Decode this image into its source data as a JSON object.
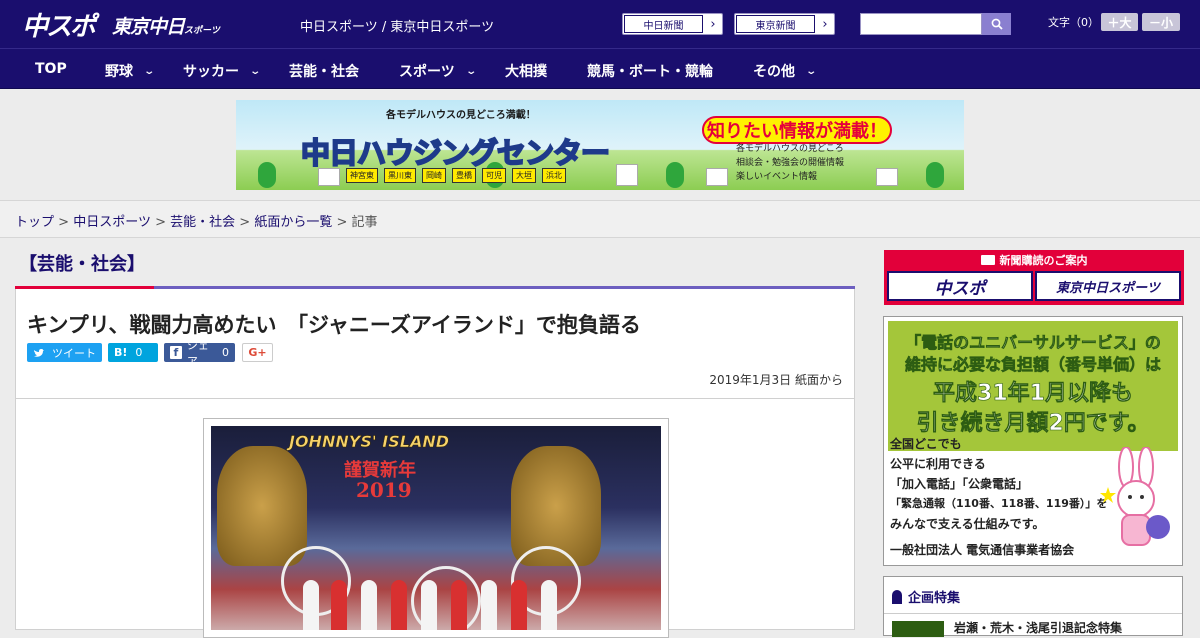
{
  "header": {
    "logo_primary": "中スポ",
    "logo_secondary": "東京中日",
    "logo_secondary_small": "スポーツ",
    "site_title": "中日スポーツ / 東京中日スポーツ",
    "paper_links": [
      {
        "label": "中日新聞"
      },
      {
        "label": "東京新聞"
      }
    ],
    "search_placeholder": "",
    "font_size_label": "文字（0）",
    "font_larger": "＋大",
    "font_smaller": "－小"
  },
  "nav": [
    {
      "label": "TOP",
      "dropdown": false
    },
    {
      "label": "野球",
      "dropdown": true
    },
    {
      "label": "サッカー",
      "dropdown": true
    },
    {
      "label": "芸能・社会",
      "dropdown": false
    },
    {
      "label": "スポーツ",
      "dropdown": true
    },
    {
      "label": "大相撲",
      "dropdown": false
    },
    {
      "label": "競馬・ボート・競輪",
      "dropdown": false
    },
    {
      "label": "その他",
      "dropdown": true
    }
  ],
  "banner": {
    "top_text": "各モデルハウスの見どころ満載！",
    "main_text": "中日ハウジングセンター",
    "bubble_text": "知りたい情報が満載！",
    "list": [
      "各モデルハウスの見どころ",
      "相談会・勉強会の開催情報",
      "楽しいイベント情報"
    ],
    "cities": [
      "神宮東",
      "黒川東",
      "岡崎",
      "豊橋",
      "可児",
      "大垣",
      "浜北"
    ]
  },
  "breadcrumb": {
    "items": [
      "トップ",
      "中日スポーツ",
      "芸能・社会",
      "紙面から一覧"
    ],
    "current": "記事",
    "separator": ">"
  },
  "section_title": "【芸能・社会】",
  "article": {
    "title": "キンプリ、戦闘力高めたい　「ジャニーズアイランド」で抱負語る",
    "share": {
      "tweet": "ツイート",
      "hatena": "B!",
      "hatena_count": "0",
      "facebook": "シェア",
      "facebook_count": "0",
      "gplus": "G+"
    },
    "date": "2019年1月3日 紙面から",
    "photo": {
      "title_text": "JOHNNYS' ISLAND",
      "greeting": "謹賀新年",
      "year": "2019"
    }
  },
  "sidebar": {
    "subscribe_header": "新聞購読のご案内",
    "subscribe_links": [
      {
        "label": "中スポ"
      },
      {
        "label": "東京中日スポーツ"
      }
    ],
    "universal_ad": {
      "line1": "「電話のユニバーサルサービス」の",
      "line2": "維持に必要な負担額（番号単価）は",
      "line3": "平成31年1月以降も",
      "line4": "引き続き月額2円です。",
      "body": [
        "全国どこでも",
        "公平に利用できる",
        "「加入電話」「公衆電話」",
        "「緊急通報（110番、118番、119番）」を",
        "みんなで支える仕組みです。"
      ],
      "footer": "一般社団法人 電気通信事業者協会"
    },
    "feature_header": "企画特集",
    "feature_item": "岩瀬・荒木・浅尾引退記念特集"
  },
  "colors": {
    "header_bg": "#1a0e6e",
    "accent_red": "#e2003a",
    "section_line": "#6d5fc0",
    "twitter": "#1da1f2",
    "hatena": "#00a4de",
    "facebook": "#3b5998"
  }
}
